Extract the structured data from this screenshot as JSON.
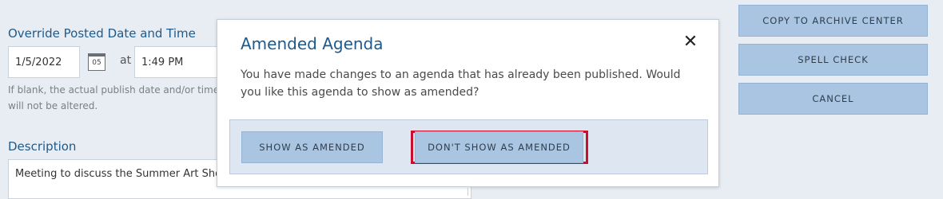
{
  "form": {
    "override_label": "Override Posted Date and Time",
    "date_value": "1/5/2022",
    "calendar_day": "05",
    "at_label": "at",
    "time_value": "1:49 PM",
    "help_text": "If blank, the actual publish date and/or time will not be altered.",
    "description_label": "Description",
    "description_value": "Meeting to discuss the Summer Art Show"
  },
  "side_buttons": {
    "copy_to_archive": "COPY TO ARCHIVE CENTER",
    "spell_check": "SPELL CHECK",
    "cancel": "CANCEL"
  },
  "modal": {
    "title": "Amended Agenda",
    "close_glyph": "✕",
    "message": "You have made changes to an agenda that has already been published. Would you like this agenda to show as amended?",
    "show_as_amended": "SHOW AS AMENDED",
    "dont_show_as_amended": "DON'T SHOW AS AMENDED"
  },
  "colors": {
    "title_blue": "#1e5a8c",
    "button_blue": "#a9c5e2",
    "highlight_red": "#c8102e",
    "background": "#e8edf3"
  }
}
